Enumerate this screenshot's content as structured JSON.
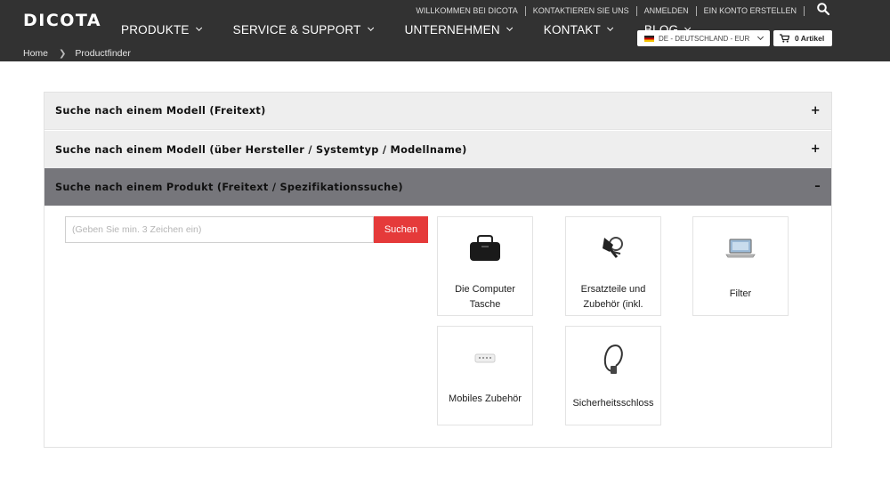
{
  "brand": {
    "logo": "DICOTA"
  },
  "topnav": {
    "links": [
      "WILLKOMMEN BEI DICOTA",
      "KONTAKTIEREN SIE UNS",
      "ANMELDEN",
      "EIN KONTO ERSTELLEN"
    ],
    "search_icon": "search-icon"
  },
  "mainnav": {
    "items": [
      "PRODUKTE",
      "SERVICE & SUPPORT",
      "UNTERNEHMEN",
      "KONTAKT",
      "BLOG"
    ]
  },
  "breadcrumb": {
    "home": "Home",
    "current": "Productfinder"
  },
  "locale": {
    "selected": "DE - DEUTSCHLAND - EUR"
  },
  "cart": {
    "label": "0 Artikel"
  },
  "accordion": {
    "sections": [
      {
        "title": "Suche nach einem Modell (Freitext)",
        "sign": "+"
      },
      {
        "title": "Suche nach einem Modell (über Hersteller / Systemtyp / Modellname)",
        "sign": "+"
      },
      {
        "title": "Suche nach einem Produkt (Freitext / Spezifikationssuche)",
        "sign": "–"
      }
    ]
  },
  "product_search": {
    "placeholder": "(Geben Sie min. 3 Zeichen ein)",
    "button": "Suchen"
  },
  "categories": [
    {
      "label": "Die Computer Tasche",
      "icon": "computer-bag-icon"
    },
    {
      "label": "Ersatzteile und Zubehör (inkl.",
      "icon": "spare-parts-icon"
    },
    {
      "label": "Filter",
      "icon": "privacy-filter-icon"
    },
    {
      "label": "Mobiles Zubehör",
      "icon": "mobile-accessory-icon"
    },
    {
      "label": "Sicherheitsschloss",
      "icon": "security-lock-icon"
    }
  ],
  "colors": {
    "header_bg": "#323232",
    "active_section_bg": "#76767b",
    "section_bg": "#eeeeee",
    "accent_red": "#e53a3a"
  }
}
